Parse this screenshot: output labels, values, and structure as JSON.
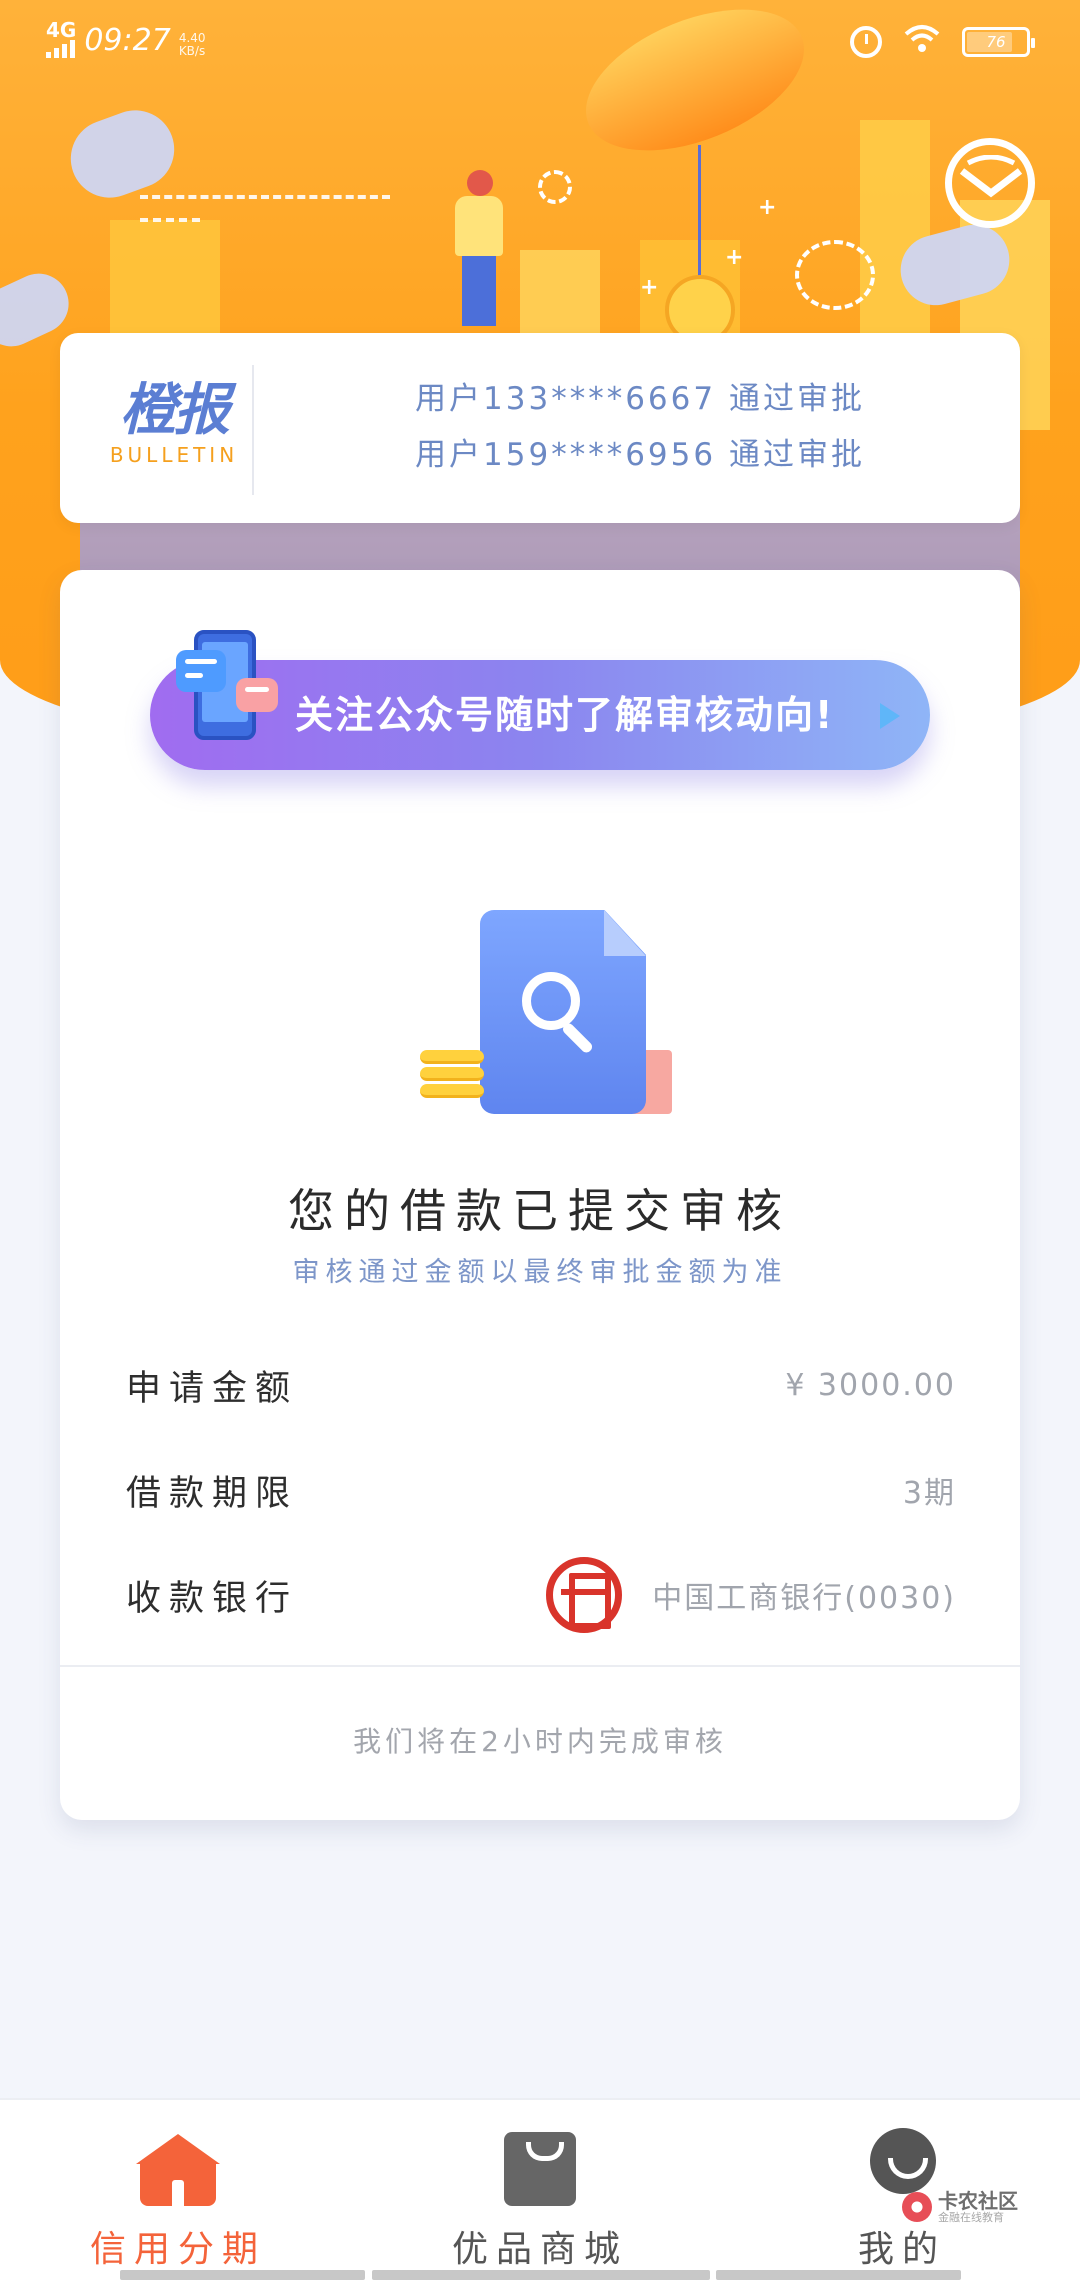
{
  "status_bar": {
    "network": "4G",
    "time": "09:27",
    "speed_value": "4.40",
    "speed_unit": "KB/s",
    "battery": "76"
  },
  "bulletin": {
    "logo_cn": "橙报",
    "logo_en": "BULLETIN",
    "lines": [
      "用户133****6667 通过审批",
      "用户159****6956 通过审批"
    ]
  },
  "banner": {
    "text": "关注公众号随时了解审核动向!"
  },
  "status": {
    "title": "您的借款已提交审核",
    "subtitle": "审核通过金额以最终审批金额为准"
  },
  "details": [
    {
      "label": "申请金额",
      "value": "¥ 3000.00"
    },
    {
      "label": "借款期限",
      "value": "3期"
    },
    {
      "label": "收款银行",
      "value": "中国工商银行(0030)"
    }
  ],
  "footer_note": "我们将在2小时内完成审核",
  "tabs": [
    {
      "label": "信用分期",
      "icon": "home-icon",
      "active": true
    },
    {
      "label": "优品商城",
      "icon": "shopping-bag-icon",
      "active": false
    },
    {
      "label": "我的",
      "icon": "profile-icon",
      "active": false
    }
  ],
  "watermark": {
    "title": "卡农社区",
    "subtitle": "金融在线教育"
  },
  "colors": {
    "hero_orange": "#ffa21d",
    "accent_tab": "#f4633a",
    "bulletin_text": "#6c89c4",
    "icbc_red": "#d9342b"
  }
}
